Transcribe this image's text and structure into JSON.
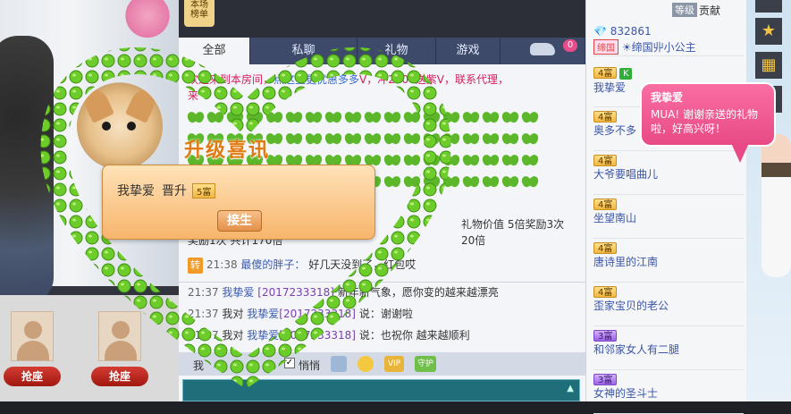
{
  "top": {
    "rank_tag": "本场\n榜单"
  },
  "seats": [
    {
      "label": "抢座"
    },
    {
      "label": "抢座"
    }
  ],
  "tabs": [
    {
      "label": "全部"
    },
    {
      "label": "私聊"
    },
    {
      "label": "礼物"
    },
    {
      "label": "游戏"
    },
    {
      "label": "",
      "badge": "0"
    }
  ],
  "notice": {
    "line1a": "欢迎来到本房间，",
    "line1b": "点这里更优惠多多",
    "line1c": "V，冲2000送紫V，联系代理，",
    "line2": "来"
  },
  "upgrade": {
    "title": "升级喜讯",
    "user": "我挚爱",
    "action": "晋升",
    "level": "5富",
    "button": "接生"
  },
  "messages": [
    {
      "text": "礼物价值 5倍奖励3次 20倍"
    },
    {
      "text": "奖励1次 共计170倍"
    },
    {
      "prefix": "转",
      "time": "21:38",
      "name": "最傻的胖子：",
      "text": "好几天没到了，红包哎"
    },
    {
      "time": "21:37",
      "name": "我挚爱",
      "link": "[2017233318]",
      "text": "新年新气象，愿你变的越来越漂亮"
    },
    {
      "time": "21:37",
      "name": "我对",
      "name2": "我挚爱",
      "link": "[2017233318]",
      "text": "说：谢谢啦"
    },
    {
      "time": "21:37",
      "name": "我对",
      "name2": "我挚爱",
      "link": "[2017233318]",
      "text": "说：也祝你 越来越顺利"
    }
  ],
  "toolbar": {
    "to_label": "我",
    "quiet_label": "悄悄",
    "vip_label": "VIP",
    "guard_label": "守护"
  },
  "right_list": {
    "head_grade": "等级",
    "head_contrib": "贡献",
    "top_id": "832861",
    "top_badge": "缔国",
    "top_name": "☀缔国丱小公主",
    "items": [
      {
        "level": "4富",
        "extra": "K",
        "name": "我挚爱"
      },
      {
        "level": "4富",
        "name": "奥多不多"
      },
      {
        "level": "4富",
        "name": "大爷要唱曲儿"
      },
      {
        "level": "4富",
        "name": "坐望南山"
      },
      {
        "level": "4富",
        "name": "唐诗里的江南"
      },
      {
        "level": "4富",
        "name": "歪家宝贝的老公"
      },
      {
        "level": "3富",
        "name": "和邻家女人有二腿"
      },
      {
        "level": "3富",
        "name": "女神的圣斗士"
      }
    ]
  },
  "bubble": {
    "who": "我挚爱",
    "text": "MUA! 谢谢亲送的礼物啦，好高兴呀！"
  },
  "colors": {
    "accent_pink": "#e84a86",
    "tab_bar": "#3e4a6a",
    "clover_green": "#5cb82a"
  },
  "icons": [
    "star-icon",
    "gift-icon",
    "heart-icon"
  ]
}
